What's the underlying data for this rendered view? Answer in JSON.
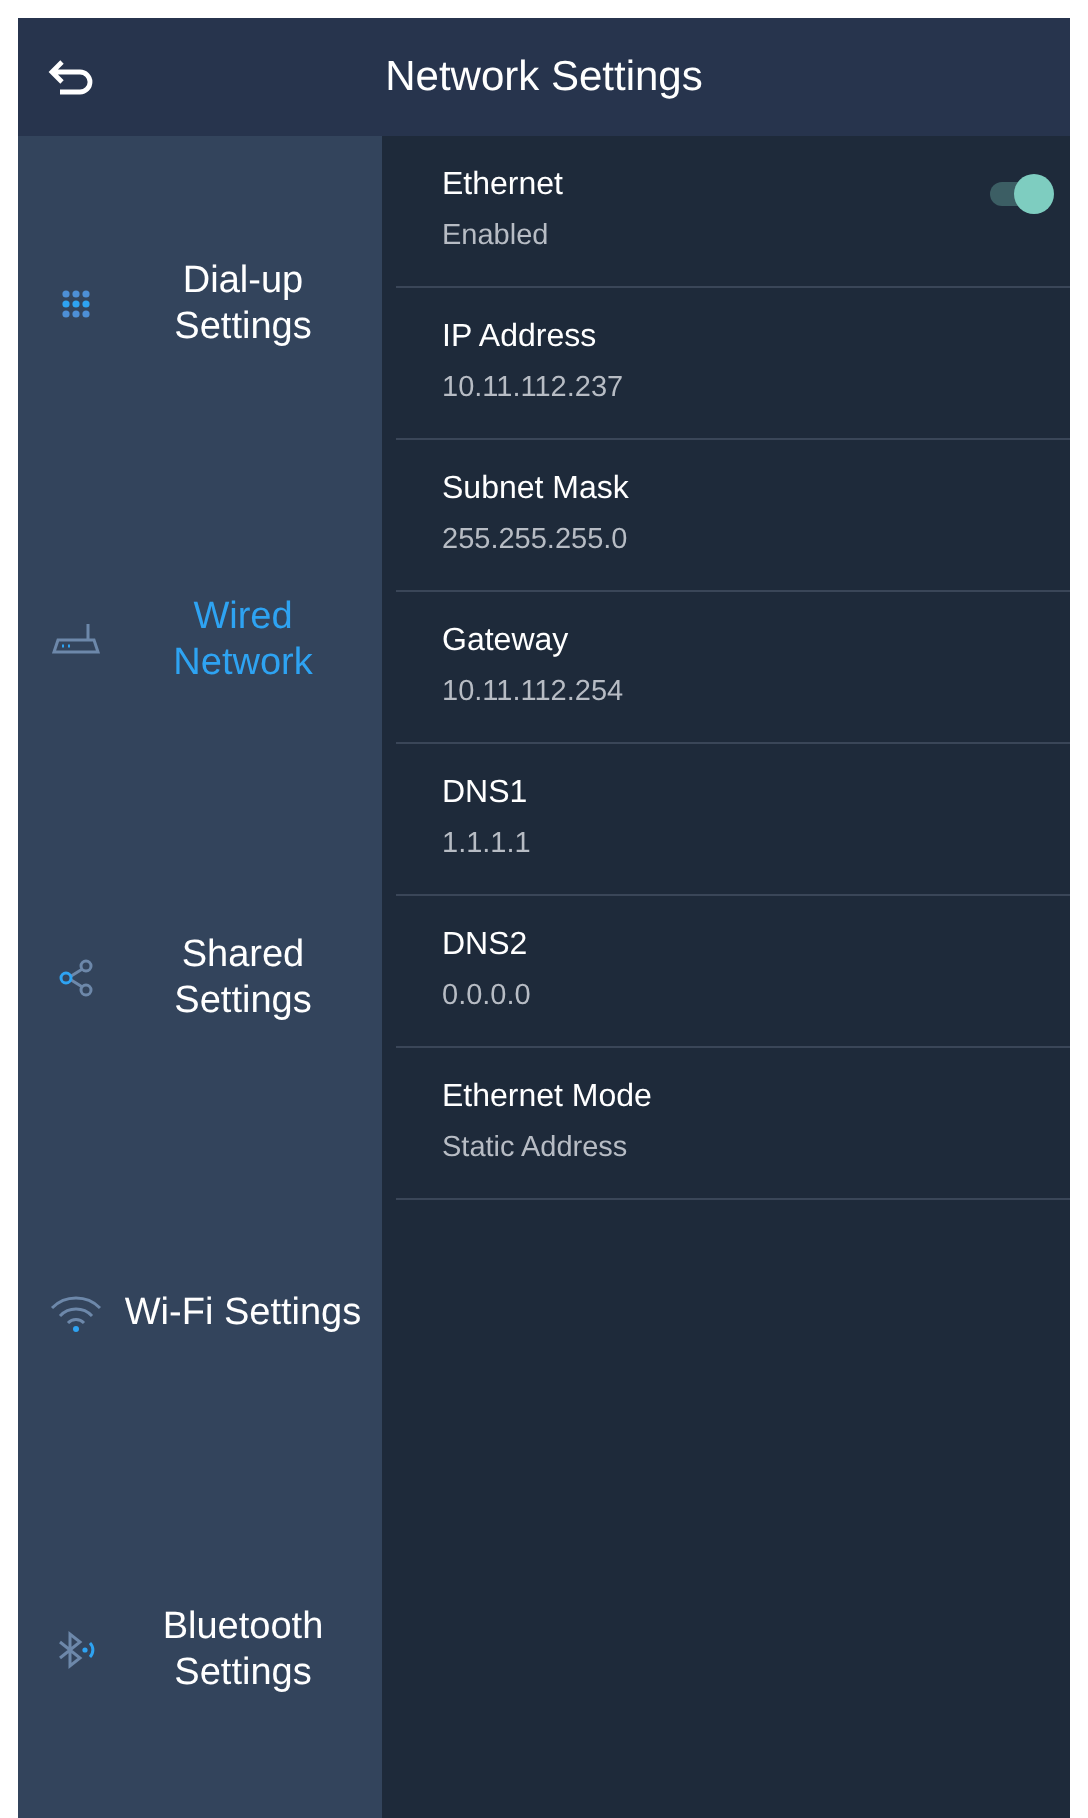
{
  "header": {
    "title": "Network Settings"
  },
  "sidebar": {
    "items": [
      {
        "kind": "dialpad",
        "label": "Dial-up Settings",
        "selected": false
      },
      {
        "kind": "router",
        "label": "Wired Network",
        "selected": true
      },
      {
        "kind": "share",
        "label": "Shared Settings",
        "selected": false
      },
      {
        "kind": "wifi",
        "label": "Wi-Fi Settings",
        "selected": false
      },
      {
        "kind": "bluetooth",
        "label": "Bluetooth Settings",
        "selected": false
      }
    ]
  },
  "settings": [
    {
      "kind": "toggle",
      "label": "Ethernet",
      "value": "Enabled",
      "on": true
    },
    {
      "kind": "info",
      "label": "IP Address",
      "value": "10.11.112.237"
    },
    {
      "kind": "info",
      "label": "Subnet Mask",
      "value": "255.255.255.0"
    },
    {
      "kind": "info",
      "label": "Gateway",
      "value": "10.11.112.254"
    },
    {
      "kind": "info",
      "label": "DNS1",
      "value": "1.1.1.1"
    },
    {
      "kind": "info",
      "label": "DNS2",
      "value": "0.0.0.0"
    },
    {
      "kind": "info",
      "label": "Ethernet Mode",
      "value": "Static Address"
    }
  ]
}
